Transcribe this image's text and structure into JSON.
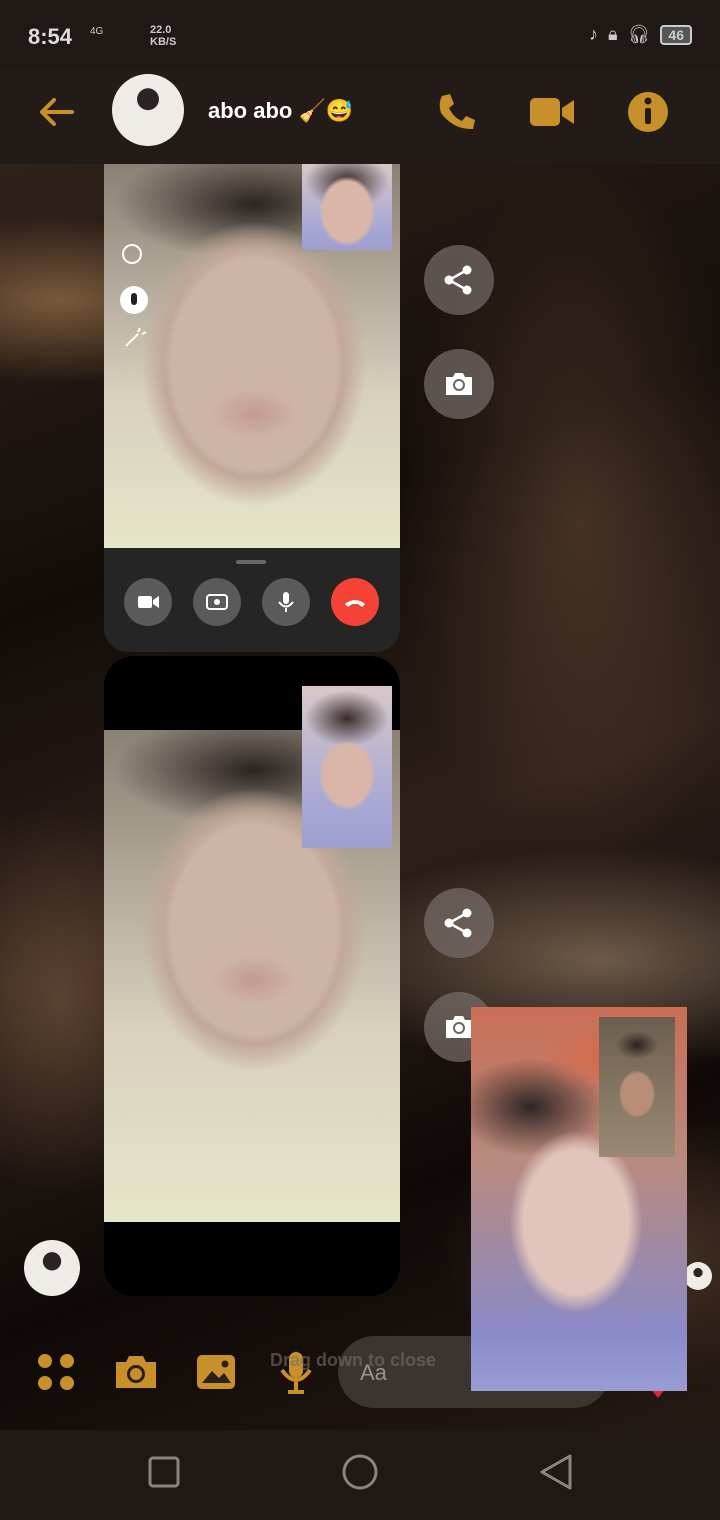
{
  "status_bar": {
    "time": "8:54",
    "network": "4G",
    "speed_value": "22.0",
    "speed_unit": "KB/S",
    "battery": "46"
  },
  "header": {
    "title": "abo abo 🧹😅"
  },
  "composer": {
    "placeholder": "Aa",
    "drag_hint": "Drag down to close"
  },
  "colors": {
    "accent": "#c8902a",
    "header_bg": "#231b17",
    "end_call": "#f44336"
  }
}
